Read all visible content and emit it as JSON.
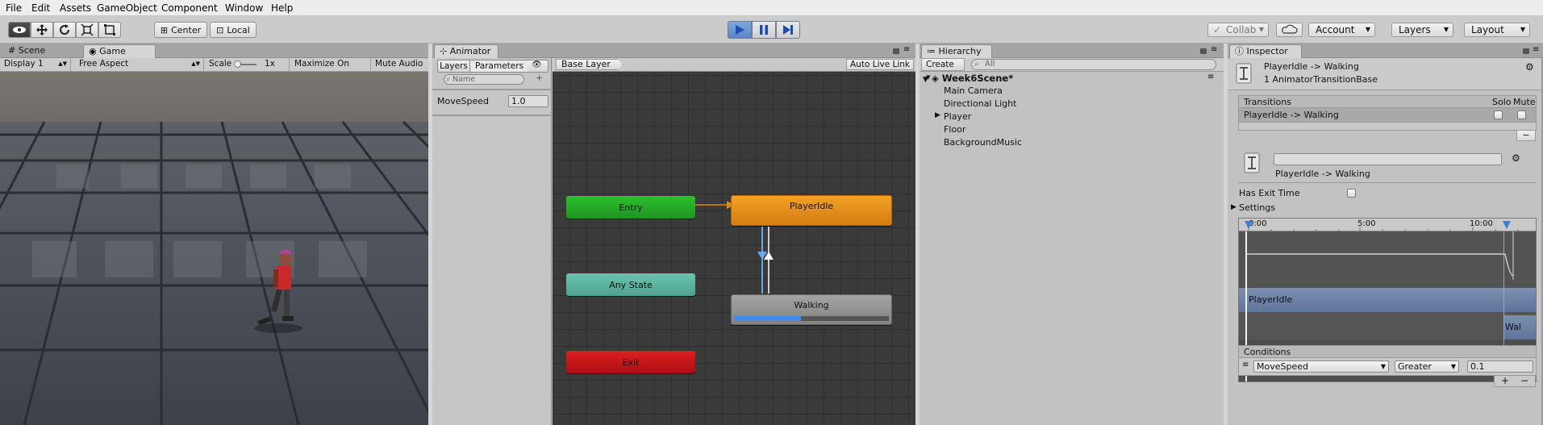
{
  "menu": [
    "File",
    "Edit",
    "Assets",
    "GameObject",
    "Component",
    "Window",
    "Help"
  ],
  "toolbar": {
    "center_label": "Center",
    "local_label": "Local",
    "collab_label": "Collab",
    "account_label": "Account",
    "layers_label": "Layers",
    "layout_label": "Layout",
    "tools": [
      "hand-icon",
      "move-icon",
      "rotate-icon",
      "scale-icon",
      "rect-tool-icon"
    ],
    "play_controls": [
      "play-icon",
      "pause-icon",
      "step-icon"
    ],
    "accent": "#3b78d8"
  },
  "scene_panel": {
    "tabs": [
      "Scene",
      "Game"
    ],
    "display": "Display 1",
    "aspect": "Free Aspect",
    "scale_label": "Scale",
    "scale_value": "1x",
    "maximize_label": "Maximize On Play",
    "mute_label": "Mute Audio"
  },
  "animator": {
    "tab": "Animator",
    "subtabs": [
      "Layers",
      "Parameters"
    ],
    "search_placeholder": "Name",
    "add_label": "+",
    "layer_name": "Base Layer",
    "auto_live_link": "Auto Live Link",
    "parameters": [
      {
        "name": "MoveSpeed",
        "value": "1.0"
      }
    ],
    "nodes": {
      "entry": "Entry",
      "any_state": "Any State",
      "exit": "Exit",
      "player_idle": "PlayerIdle",
      "walking": "Walking"
    },
    "walking_progress": 0.43,
    "colors": {
      "entry": "#23a02a",
      "any": "#5aaf9d",
      "exit": "#c2161a",
      "idle": "#e08816",
      "walking": "#8c8c8c",
      "grid": "#3b3b3b"
    }
  },
  "hierarchy": {
    "tab": "Hierarchy",
    "create_label": "Create",
    "search_placeholder": "All",
    "scene_name": "Week6Scene*",
    "items": [
      "Main Camera",
      "Directional Light",
      "Player",
      "Floor",
      "BackgroundMusic"
    ]
  },
  "inspector": {
    "tab": "Inspector",
    "title": "PlayerIdle -> Walking",
    "subtitle": "1 AnimatorTransitionBase",
    "transitions_header": "Transitions",
    "solo_label": "Solo",
    "mute_label": "Mute",
    "transition_row": "PlayerIdle -> Walking",
    "remove_label": "−",
    "transition_name_field": "",
    "transition_title": "PlayerIdle -> Walking",
    "has_exit_time_label": "Has Exit Time",
    "settings_label": "Settings",
    "timeline_ticks": [
      "0:00",
      "5:00",
      "10:00"
    ],
    "timeline_state1": "PlayerIdle",
    "timeline_state2": "Wal",
    "conditions_header": "Conditions",
    "condition": {
      "param": "MoveSpeed",
      "op": "Greater",
      "value": "0.1"
    },
    "add_label": "+",
    "minus_label": "−"
  }
}
